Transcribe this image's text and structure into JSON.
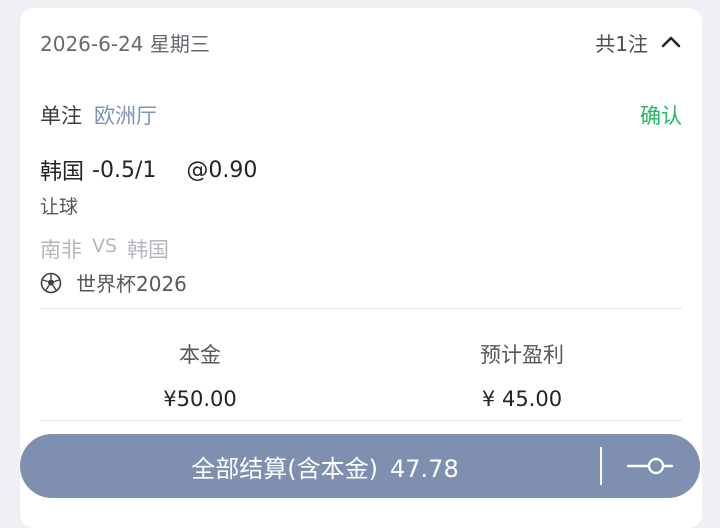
{
  "header": {
    "date": "2026-6-24 星期三",
    "bet_count": "共1注"
  },
  "bet": {
    "type": "单注",
    "venue": "欧洲厅",
    "status": "确认",
    "selection_team": "韩国",
    "handicap": "-0.5/1",
    "odds": "@0.90",
    "market": "让球",
    "home_team": "南非",
    "vs": "VS",
    "away_team": "韩国",
    "league": "世界杯2026",
    "league_icon": "soccer-ball-icon"
  },
  "stats": {
    "stake_label": "本金",
    "stake_value": "¥50.00",
    "profit_label": "预计盈利",
    "profit_value": "¥ 45.00"
  },
  "settle": {
    "label": "全部结算(含本金)",
    "amount": "47.78",
    "icon": "slider-toggle-icon"
  },
  "colors": {
    "venue": "#7f93b8",
    "confirm": "#27b860",
    "settle_button": "#7e8fb0"
  }
}
